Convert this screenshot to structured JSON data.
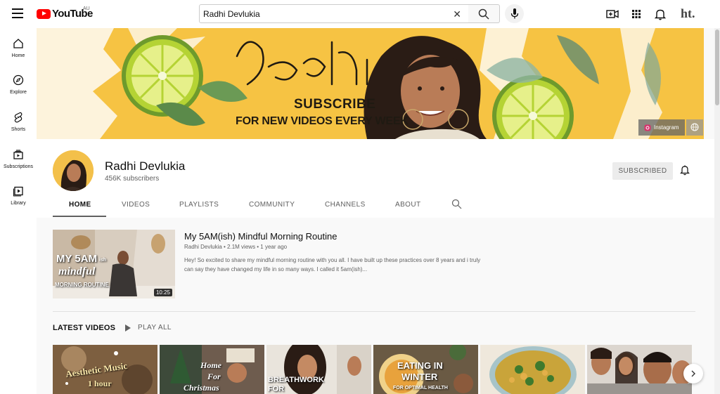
{
  "header": {
    "logo_text": "YouTube",
    "region": "AU",
    "search_value": "Radhi Devlukia",
    "search_placeholder": "Search",
    "account_initials": "ht."
  },
  "sidebar": {
    "items": [
      {
        "label": "Home",
        "icon": "home-icon"
      },
      {
        "label": "Explore",
        "icon": "compass-icon"
      },
      {
        "label": "Shorts",
        "icon": "shorts-icon"
      },
      {
        "label": "Subscriptions",
        "icon": "subscriptions-icon"
      },
      {
        "label": "Library",
        "icon": "library-icon"
      }
    ]
  },
  "banner": {
    "script_name": "Radhi",
    "subscribe": "SUBSCRIBE",
    "tagline": "FOR NEW VIDEOS EVERY WEEK",
    "link_label": "Instagram"
  },
  "channel": {
    "name": "Radhi Devlukia",
    "subscribers": "456K subscribers",
    "subscribed_label": "SUBSCRIBED",
    "tabs": [
      "HOME",
      "VIDEOS",
      "PLAYLISTS",
      "COMMUNITY",
      "CHANNELS",
      "ABOUT"
    ]
  },
  "featured": {
    "title": "My 5AM(ish) Mindful Morning Routine",
    "meta": "Radhi Devlukia • 2.1M views • 1 year ago",
    "description": "Hey! So excited to share my mindful morning routine with you all. I have built up these practices over 8 years and i truly can say they have changed my life in so many ways. I called it 5am(ish)...",
    "duration": "10:25",
    "thumb_line1": "MY 5AM",
    "thumb_ish": "ish",
    "thumb_line2": "mindful",
    "thumb_line3": "MORNING ROUTINE"
  },
  "latest": {
    "title": "LATEST VIDEOS",
    "play_all": "PLAY ALL",
    "videos": [
      {
        "text1": "Aesthetic Music",
        "text2": "1 hour"
      },
      {
        "text1": "Home",
        "text2": "For",
        "text3": "Christmas"
      },
      {
        "text1": "BREATHWORK",
        "text2": "FOR"
      },
      {
        "text1": "EATING IN",
        "text2": "WINTER",
        "text3": "FOR OPTIMAL HEALTH"
      },
      {
        "text1": ""
      },
      {
        "text1": ""
      }
    ]
  },
  "colors": {
    "banner_yellow": "#f6c343",
    "lime": "#b5d334",
    "youtube_red": "#ff0000"
  }
}
